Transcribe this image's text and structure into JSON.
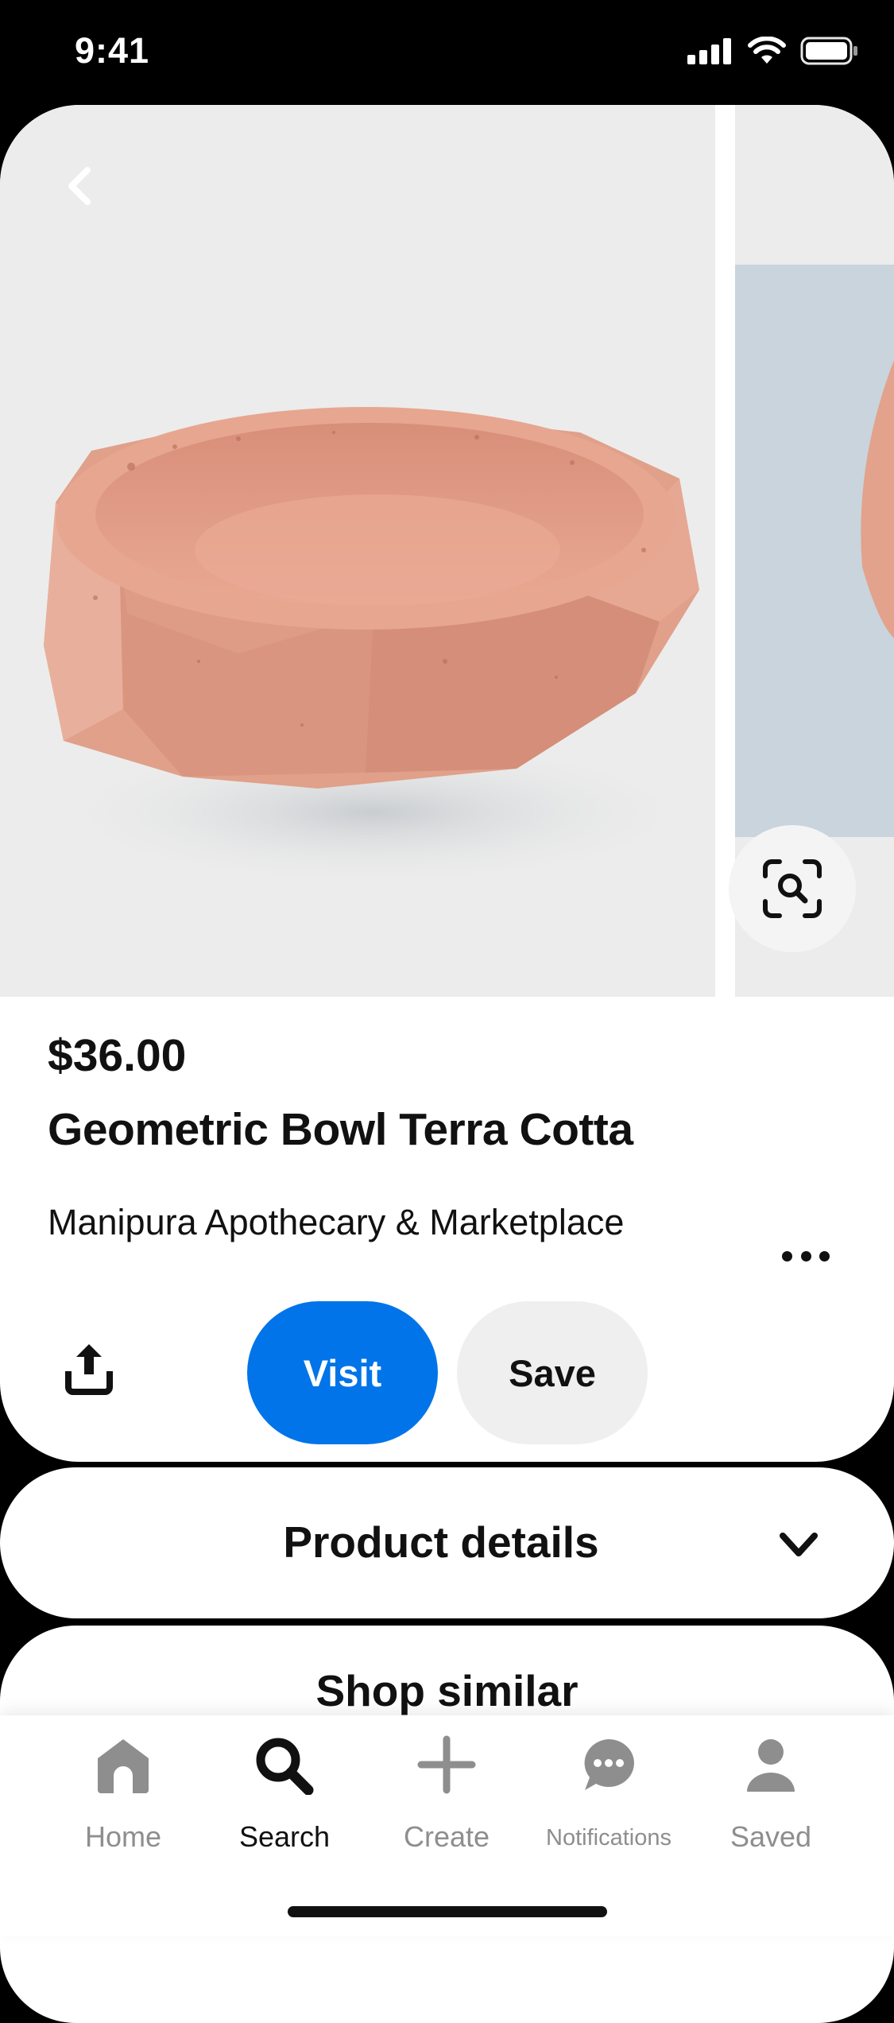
{
  "status_bar": {
    "time": "9:41"
  },
  "product": {
    "price": "$36.00",
    "title": "Geometric Bowl Terra Cotta",
    "merchant": "Manipura Apothecary & Marketplace"
  },
  "actions": {
    "visit_label": "Visit",
    "save_label": "Save"
  },
  "sections": {
    "details_label": "Product details",
    "similar_label": "Shop similar"
  },
  "tab_bar": {
    "items": [
      {
        "label": "Home",
        "icon": "home-icon"
      },
      {
        "label": "Search",
        "icon": "search-icon",
        "active": true
      },
      {
        "label": "Create",
        "icon": "plus-icon"
      },
      {
        "label": "Notifications",
        "icon": "chat-bubble-icon"
      },
      {
        "label": "Saved",
        "icon": "person-icon"
      }
    ]
  },
  "colors": {
    "visit_button": "#0074e8",
    "save_button": "#efefef",
    "product_bowl": "#e29e87"
  }
}
